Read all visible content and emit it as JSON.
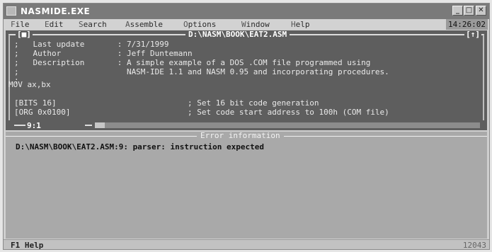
{
  "window": {
    "title": "NASMIDE.EXE",
    "minimize_label": "_",
    "maximize_label": "□",
    "close_label": "✕"
  },
  "menu": {
    "items": [
      {
        "hotkey": "F",
        "rest": "ile"
      },
      {
        "hotkey": "E",
        "rest": "dit"
      },
      {
        "hotkey": "S",
        "rest": "earch"
      },
      {
        "hotkey": "A",
        "rest": "ssemble"
      },
      {
        "hotkey": "O",
        "rest": "ptions"
      },
      {
        "hotkey": "W",
        "rest": "indow"
      },
      {
        "hotkey": "H",
        "rest": "elp"
      }
    ],
    "clock": "14:26:02"
  },
  "editor": {
    "close_box": "[■]",
    "filename": "D:\\NASM\\BOOK\\EAT2.ASM",
    "zoom_box": "[↑]",
    "lines": [
      ";   Last update       : 7/31/1999",
      ";   Author            : Jeff Duntemann",
      ";   Description       : A simple example of a DOS .COM file programmed using",
      ";                       NASM-IDE 1.1 and NASM 0.95 and incorporating procedures.",
      ";",
      "MOV ax,bx",
      "",
      "[BITS 16]                            ; Set 16 bit code generation",
      "[ORG 0x0100]                         ; Set code start address to 100h (COM file)"
    ],
    "cursor_position": "9:1"
  },
  "error_panel": {
    "title": "Error information",
    "messages": [
      "D:\\NASM\\BOOK\\EAT2.ASM:9: parser: instruction expected"
    ]
  },
  "statusbar": {
    "hint": "F1 Help",
    "memory": "12043"
  }
}
